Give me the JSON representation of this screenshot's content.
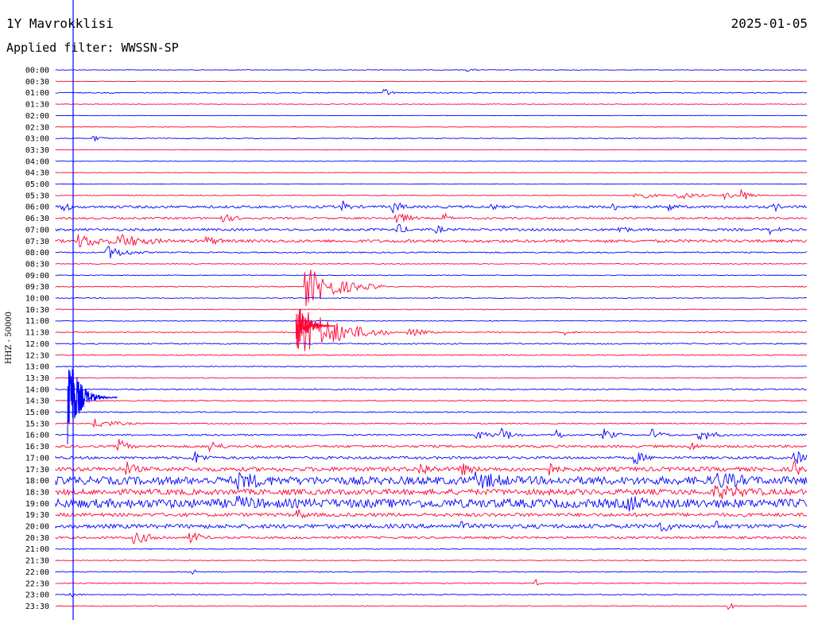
{
  "header": {
    "station": "1Y Mavrokklisi",
    "date": "2025-01-05",
    "filter": "Applied filter: WWSSN-SP"
  },
  "chart_data": {
    "type": "line",
    "title": "1Y Mavrokklisi",
    "ylabel": "HHZ - 50000",
    "grid": false,
    "colors": [
      "#0000ff",
      "#ff0033"
    ],
    "tick_labels": [
      "00:00",
      "00:30",
      "01:00",
      "01:30",
      "02:00",
      "02:30",
      "03:00",
      "03:30",
      "04:00",
      "04:30",
      "05:00",
      "05:30",
      "06:00",
      "06:30",
      "07:00",
      "07:30",
      "08:00",
      "08:30",
      "09:00",
      "09:30",
      "10:00",
      "10:30",
      "11:00",
      "11:30",
      "12:00",
      "12:30",
      "13:00",
      "13:30",
      "14:00",
      "14:30",
      "15:00",
      "15:30",
      "16:00",
      "16:30",
      "17:00",
      "17:30",
      "18:00",
      "18:30",
      "19:00",
      "19:30",
      "20:00",
      "20:30",
      "21:00",
      "21:30",
      "22:00",
      "22:30",
      "23:00",
      "23:30"
    ],
    "trace_noise": [
      0.4,
      0.3,
      0.6,
      0.4,
      0.3,
      0.3,
      0.5,
      0.3,
      0.3,
      0.3,
      0.3,
      0.5,
      1.6,
      1.2,
      1.5,
      1.8,
      0.8,
      0.5,
      0.5,
      0.6,
      0.5,
      0.5,
      0.5,
      0.6,
      0.8,
      0.6,
      0.6,
      0.5,
      0.8,
      0.7,
      0.7,
      0.6,
      1.0,
      1.5,
      1.6,
      2.6,
      5.0,
      3.5,
      5.5,
      2.2,
      2.6,
      1.4,
      0.6,
      0.5,
      0.6,
      0.6,
      0.6,
      0.5
    ]
  }
}
